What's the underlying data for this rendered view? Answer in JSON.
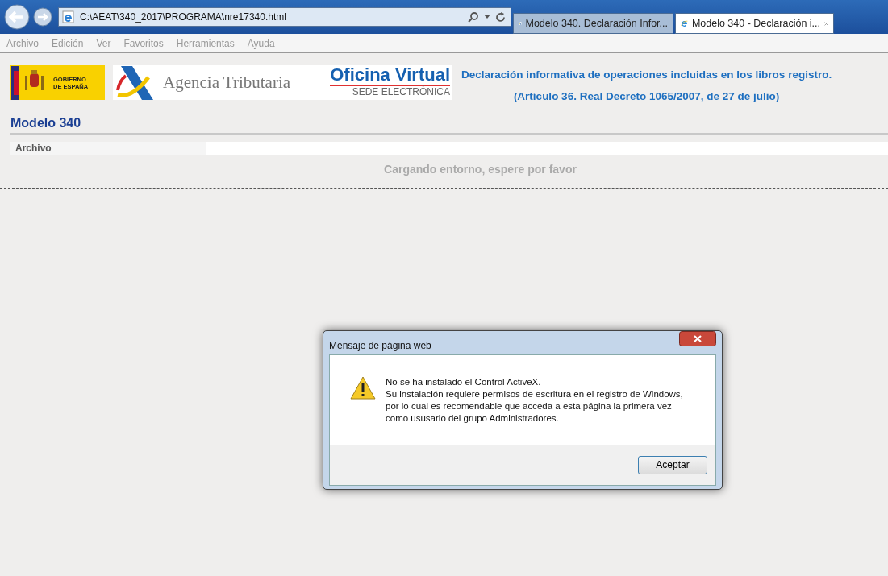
{
  "browser": {
    "address": "C:\\AEAT\\340_2017\\PROGRAMA\\nre17340.html",
    "tabs": [
      {
        "title": "Modelo 340. Declaración Infor...",
        "selected": false,
        "kind": "aeat"
      },
      {
        "title": "Modelo 340 - Declaración i...",
        "selected": true,
        "kind": "ie"
      }
    ],
    "menu": [
      "Archivo",
      "Edición",
      "Ver",
      "Favoritos",
      "Herramientas",
      "Ayuda"
    ]
  },
  "header": {
    "gobierno": [
      "GOBIERNO",
      "DE ESPAÑA"
    ],
    "agencia": "Agencia Tributaria",
    "oficina": "Oficina Virtual",
    "sede": "SEDE ELECTRÓNICA",
    "title": "Declaración informativa de operaciones incluidas en los libros registro.",
    "subtitle": "(Artículo 36. Real Decreto 1065/2007, de 27 de julio)"
  },
  "page": {
    "heading": "Modelo 340",
    "menu": [
      "Archivo"
    ],
    "loading": "Cargando entorno, espere por favor"
  },
  "dialog": {
    "title": "Mensaje de página web",
    "message": [
      "No se ha instalado el Control ActiveX.",
      "Su instalación requiere permisos de escritura en el registro de Windows,",
      "por lo cual es recomendable que acceda a esta página la primera vez",
      "como ususario del grupo Administradores."
    ],
    "button": "Aceptar"
  }
}
